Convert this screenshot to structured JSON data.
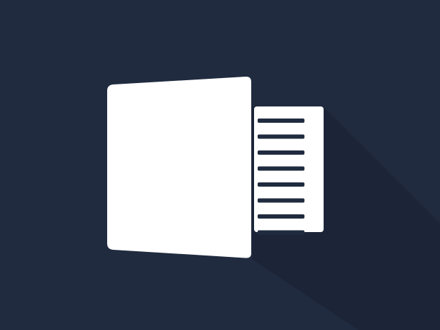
{
  "image": {
    "background_color": "#202b3f",
    "long_shadow_color": "#1c2538",
    "foreground_color": "#ffffff",
    "icon_name": "document-pages-icon",
    "line_count": 8
  }
}
